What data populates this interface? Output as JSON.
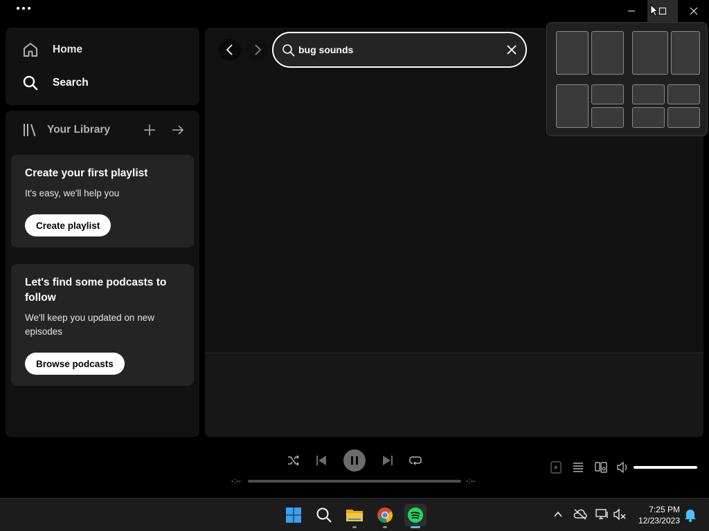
{
  "window": {
    "menu_icon": "more-horizontal-icon",
    "controls": [
      "minimize-icon",
      "maximize-icon",
      "close-icon"
    ]
  },
  "nav": {
    "home_label": "Home",
    "search_label": "Search"
  },
  "library": {
    "title": "Your Library",
    "cards": [
      {
        "title": "Create your first playlist",
        "subtitle": "It's easy, we'll help you",
        "button": "Create playlist"
      },
      {
        "title": "Let's find some podcasts to follow",
        "subtitle": "We'll keep you updated on new episodes",
        "button": "Browse podcasts"
      }
    ]
  },
  "search": {
    "value": "bug sounds"
  },
  "player": {
    "elapsed": "-:--",
    "remaining": "-:--",
    "progress_fraction": 0,
    "volume_fraction": 1
  },
  "taskbar": {
    "apps": [
      "windows-start-icon",
      "search-icon",
      "file-explorer-icon",
      "chrome-icon",
      "spotify-icon"
    ],
    "time": "7:25 PM",
    "date": "12/23/2023"
  },
  "colors": {
    "background": "#000000",
    "panel": "#121212",
    "card": "#242424",
    "spotify_green": "#1ed760",
    "taskbar_accent": "#4cc2ff"
  }
}
